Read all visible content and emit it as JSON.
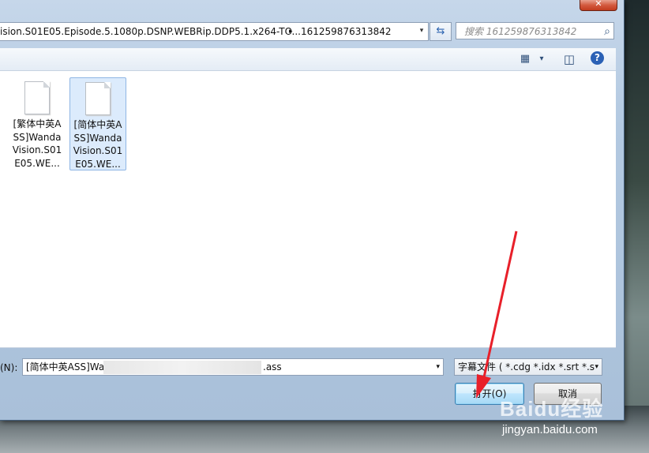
{
  "window": {
    "close_glyph": "✕"
  },
  "address_bar": {
    "path_segment_1": "ision.S01E05.Episode.5.1080p.DSNP.WEBRip.DDP5.1.x264-TO...",
    "separator": "▸",
    "path_segment_2": "161259876313842",
    "dropdown_glyph": "▾",
    "refresh_glyph": "⇆"
  },
  "search": {
    "placeholder": "搜索 161259876313842",
    "icon_glyph": "⌕"
  },
  "toolbar": {
    "view_icon_glyph": "▦",
    "view_dd_glyph": "▾",
    "preview_icon_glyph": "◫",
    "help_glyph": "?"
  },
  "files": [
    {
      "name": "[繁体中英ASS]WandaVision.S01E05.WE...",
      "selected": false
    },
    {
      "name": "[简体中英ASS]WandaVision.S01E05.WE...",
      "selected": true
    }
  ],
  "filename": {
    "label": "(N):",
    "value_start": "[简体中英ASS]Wan",
    "value_end": ".ass",
    "dropdown_glyph": "▾"
  },
  "file_type": {
    "value": "字幕文件 ( *.cdg *.idx *.srt *.s",
    "dropdown_glyph": "▾"
  },
  "buttons": {
    "open": "打开(O)",
    "cancel": "取消"
  },
  "watermark": {
    "brand": "Baidu经验",
    "url": "jingyan.baidu.com"
  },
  "colors": {
    "annotation_arrow": "#e8202a",
    "selection": "#dcebfc",
    "accent": "#2b61b5"
  }
}
